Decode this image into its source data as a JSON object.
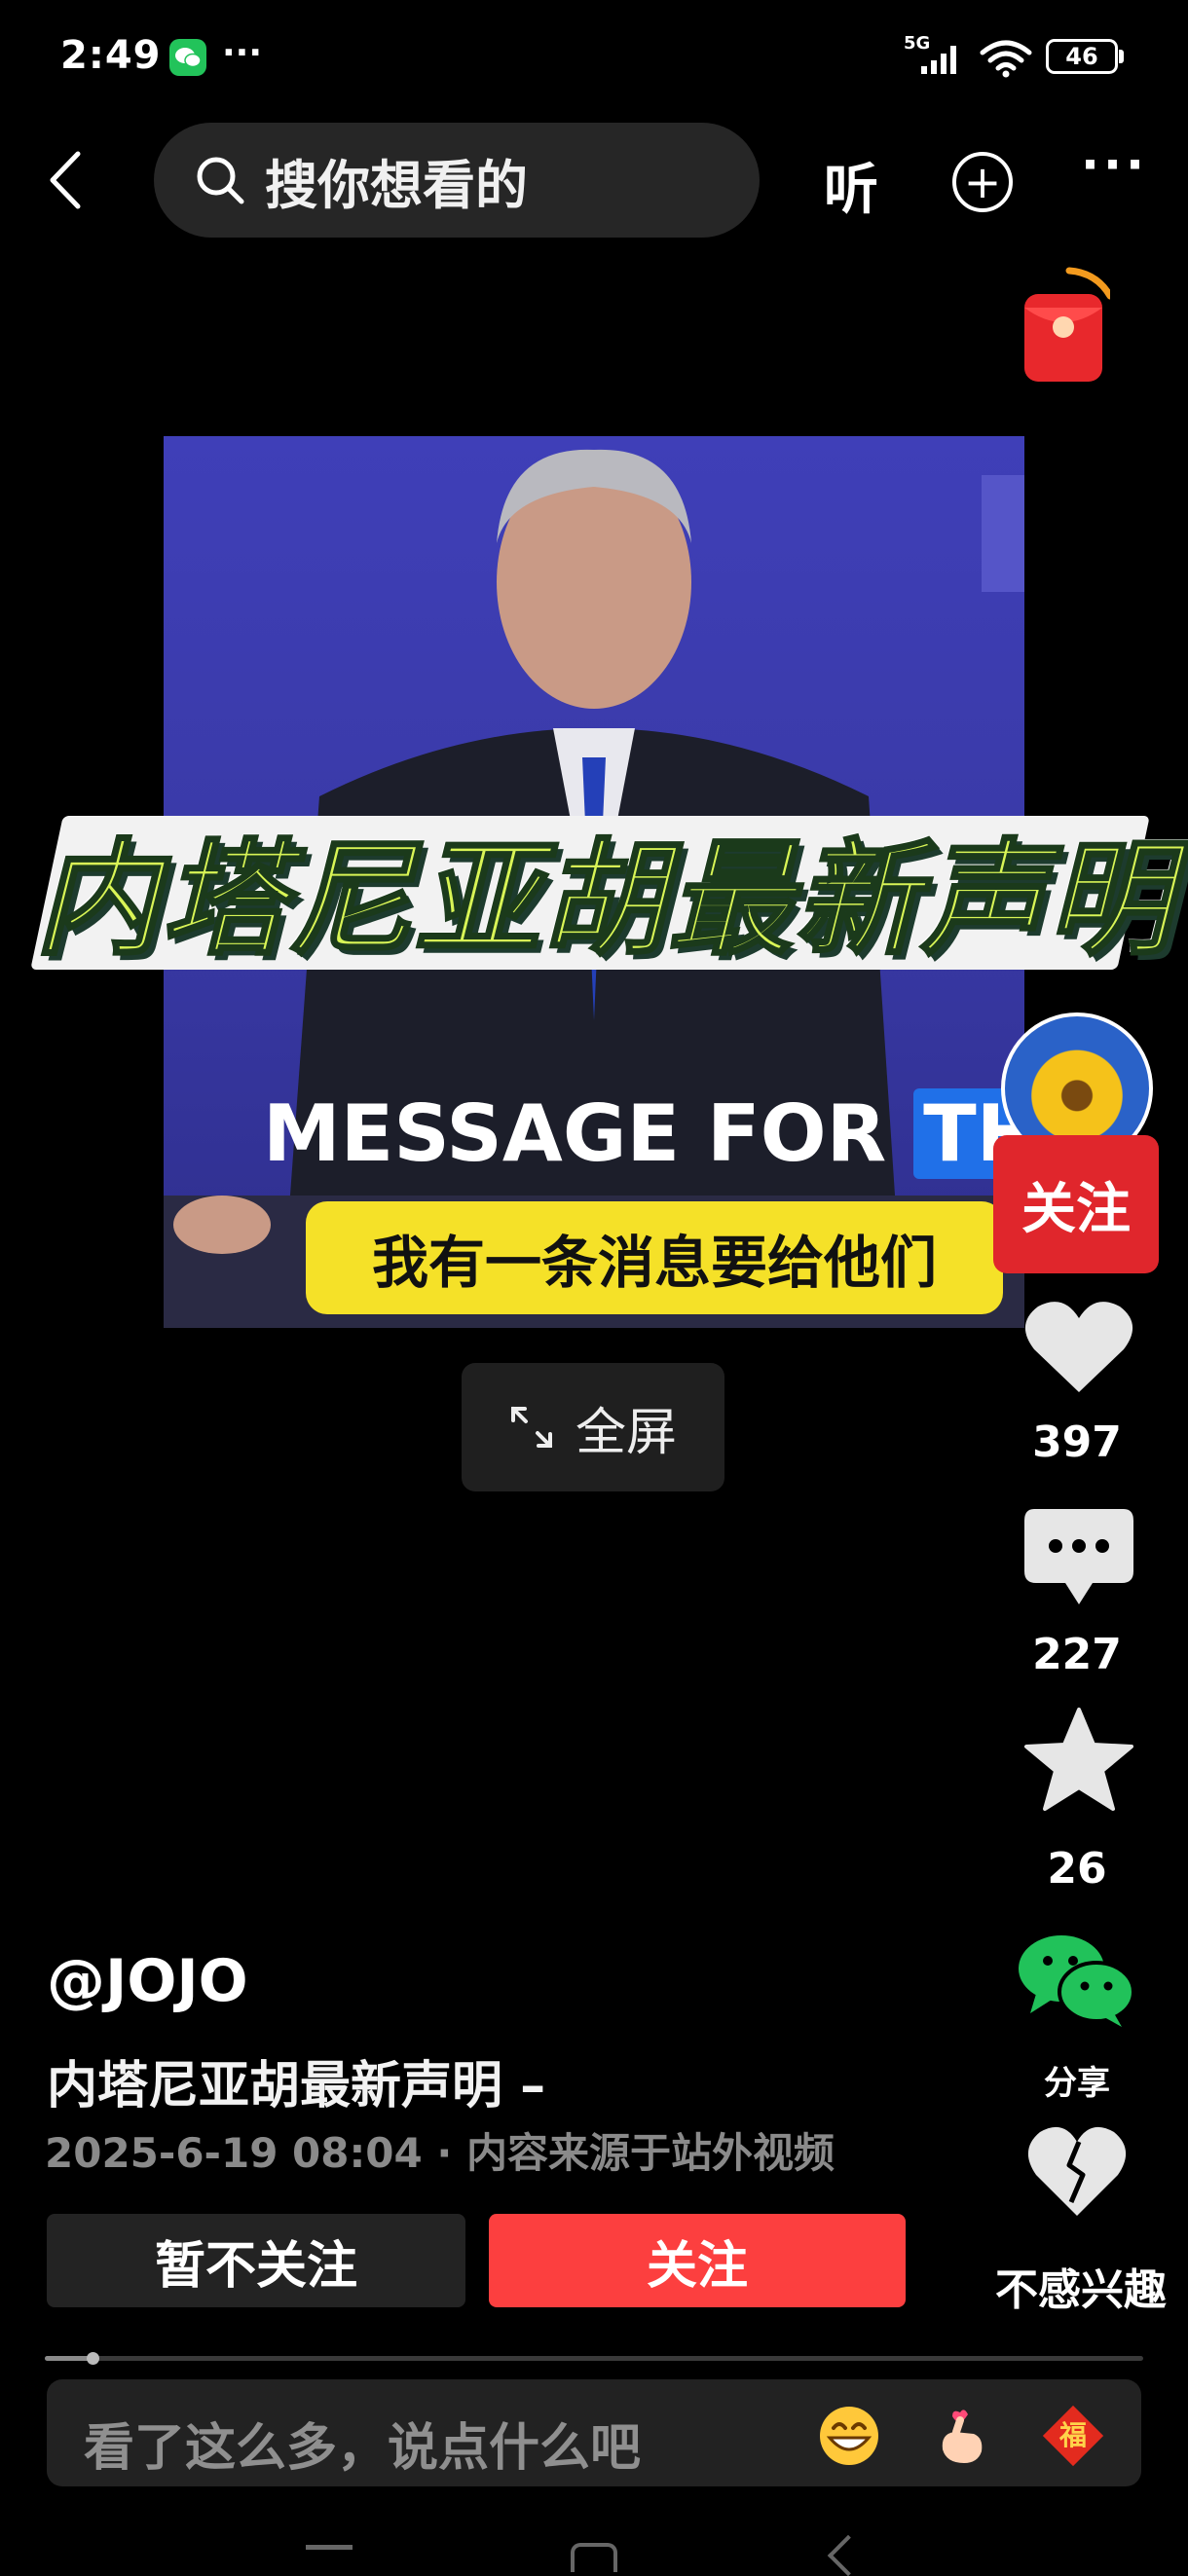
{
  "status_bar": {
    "time": "2:49",
    "dots": "···",
    "signal_label": "5G",
    "battery": "46"
  },
  "top_bar": {
    "search_placeholder": "搜你想看的",
    "listen_label": "听",
    "plus_label": "+",
    "more_label": "···"
  },
  "video": {
    "caption_title": "内塔尼亚胡最新声明",
    "message_prefix": "MESSAGE FOR ",
    "message_highlight": "THE",
    "subtitle": "我有一条消息要给他们",
    "fullscreen_label": "全屏"
  },
  "side_rail": {
    "follow_label": "关注",
    "likes": "397",
    "comments": "227",
    "favorites": "26",
    "share_label": "分享",
    "not_interested_label": "不感兴趣"
  },
  "post": {
    "author": "@JOJO",
    "description": "内塔尼亚胡最新声明 –",
    "meta": "2025-6-19 08:04 · 内容来源于站外视频",
    "unfollow_label": "暂不关注",
    "follow_label": "关注"
  },
  "playback": {
    "progress": 0.043
  },
  "comment": {
    "placeholder": "看了这么多，说点什么吧",
    "fu_label": "福"
  },
  "colors": {
    "accent_red": "#fc3f3f",
    "background": "#000000",
    "wechat_green": "#22c35a"
  }
}
